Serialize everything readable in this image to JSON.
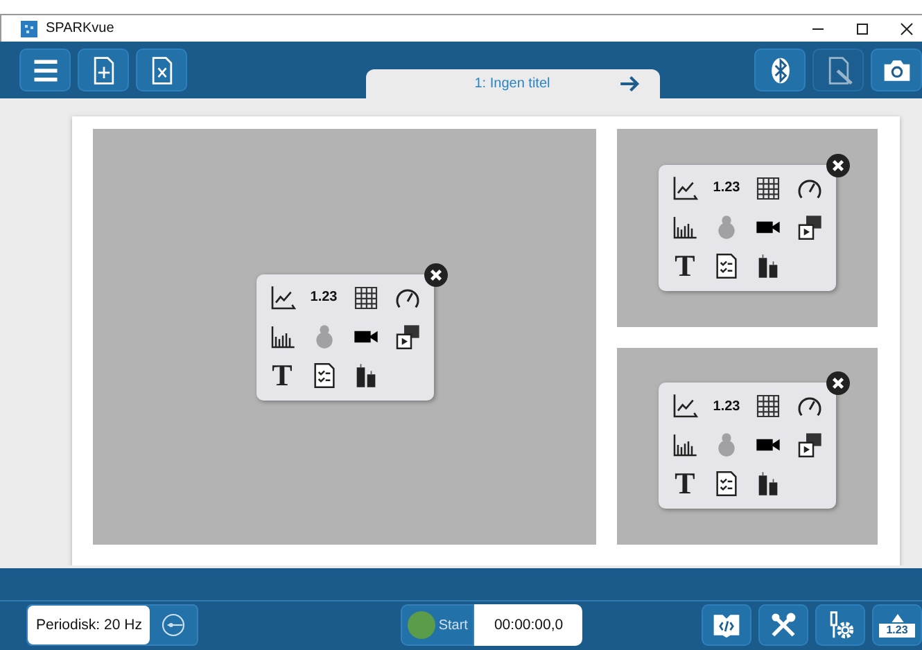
{
  "window": {
    "title": "SPARKvue"
  },
  "toolbar": {
    "left": [
      {
        "kind": "menu",
        "disabled": false
      },
      {
        "kind": "new",
        "disabled": false
      },
      {
        "kind": "close-file",
        "disabled": false
      }
    ],
    "right": [
      {
        "kind": "bluetooth",
        "disabled": false
      },
      {
        "kind": "annotate",
        "disabled": true
      },
      {
        "kind": "camera",
        "disabled": false
      }
    ]
  },
  "page_tab": {
    "label": "1: Ingen titel"
  },
  "tiles": [
    {
      "items": [
        {
          "kind": "graph",
          "disabled": false
        },
        {
          "kind": "digits",
          "label": "1.23",
          "disabled": false
        },
        {
          "kind": "table",
          "disabled": false
        },
        {
          "kind": "meter",
          "disabled": false
        },
        {
          "kind": "bars",
          "disabled": false
        },
        {
          "kind": "map",
          "disabled": true
        },
        {
          "kind": "video",
          "disabled": false
        },
        {
          "kind": "media",
          "disabled": false
        },
        {
          "kind": "text",
          "label": "T",
          "disabled": false
        },
        {
          "kind": "quiz",
          "disabled": false
        },
        {
          "kind": "energy",
          "disabled": false
        }
      ]
    },
    {
      "items": [
        {
          "kind": "graph",
          "disabled": false
        },
        {
          "kind": "digits",
          "label": "1.23",
          "disabled": false
        },
        {
          "kind": "table",
          "disabled": false
        },
        {
          "kind": "meter",
          "disabled": false
        },
        {
          "kind": "bars",
          "disabled": false
        },
        {
          "kind": "map",
          "disabled": true
        },
        {
          "kind": "video",
          "disabled": false
        },
        {
          "kind": "media",
          "disabled": false
        },
        {
          "kind": "text",
          "label": "T",
          "disabled": false
        },
        {
          "kind": "quiz",
          "disabled": false
        },
        {
          "kind": "energy",
          "disabled": false
        }
      ]
    },
    {
      "items": [
        {
          "kind": "graph",
          "disabled": false
        },
        {
          "kind": "digits",
          "label": "1.23",
          "disabled": false
        },
        {
          "kind": "table",
          "disabled": false
        },
        {
          "kind": "meter",
          "disabled": false
        },
        {
          "kind": "bars",
          "disabled": false
        },
        {
          "kind": "map",
          "disabled": true
        },
        {
          "kind": "video",
          "disabled": false
        },
        {
          "kind": "media",
          "disabled": false
        },
        {
          "kind": "text",
          "label": "T",
          "disabled": false
        },
        {
          "kind": "quiz",
          "disabled": false
        },
        {
          "kind": "energy",
          "disabled": false
        }
      ]
    }
  ],
  "bottom_bar": {
    "sampling": "Periodisk: 20 Hz",
    "start": {
      "label": "Start"
    },
    "timer": "00:00:00,0",
    "tools": [
      {
        "kind": "code"
      },
      {
        "kind": "tools"
      },
      {
        "kind": "sensor-setup"
      },
      {
        "kind": "digits",
        "label": "1.23"
      }
    ]
  }
}
